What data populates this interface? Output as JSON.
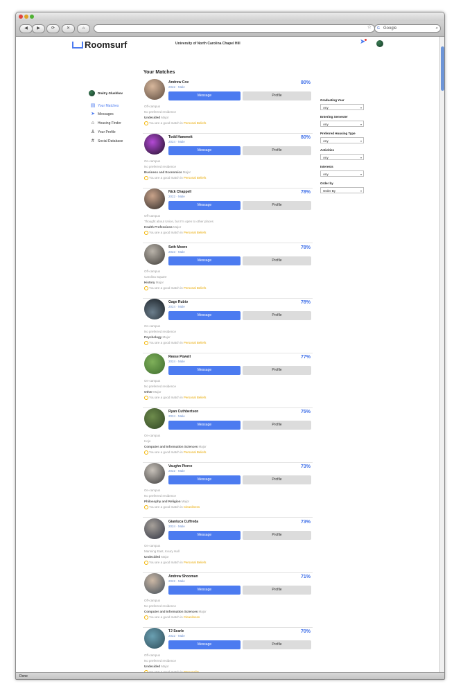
{
  "browser": {
    "search_label": "Google",
    "status_text": "Done"
  },
  "header": {
    "logo": "Roomsurf",
    "school": "University of North Carolina Chapel Hill"
  },
  "sidebar": {
    "user_name": "Dmitry Glushkov",
    "items": [
      {
        "label": "Your Matches",
        "icon": "matches-icon"
      },
      {
        "label": "Messages",
        "icon": "messages-icon"
      },
      {
        "label": "Housing Finder",
        "icon": "house-icon"
      },
      {
        "label": "Your Profile",
        "icon": "user-icon"
      },
      {
        "label": "Social Database",
        "icon": "hashtag-icon"
      }
    ]
  },
  "main": {
    "heading": "Your Matches",
    "message_label": "Message",
    "profile_label": "Profile",
    "match_prefix": "You are a good match in ",
    "major_suffix": "Major",
    "matches": [
      {
        "name": "Andrew Cox",
        "meta": "2022 · Male",
        "pct": "80%",
        "housing": "Off-campus",
        "residence": "No preferred residence",
        "major": "Undecided",
        "trait": "Personal Beliefs"
      },
      {
        "name": "Todd Hammett",
        "meta": "2024 · Male",
        "pct": "80%",
        "housing": "On-campus",
        "residence": "No preferred residence",
        "major": "Business and Economics",
        "trait": "Personal Beliefs"
      },
      {
        "name": "Nick Chappell",
        "meta": "2022 · Male",
        "pct": "78%",
        "housing": "Off-campus",
        "residence": "Thought about Union, but I'm open to other places",
        "major": "Health Professions",
        "trait": "Personal Beliefs"
      },
      {
        "name": "Seth Moore",
        "meta": "2023 · Male",
        "pct": "78%",
        "housing": "Off-campus",
        "residence": "Carolina Square",
        "major": "History",
        "trait": "Personal Beliefs"
      },
      {
        "name": "Gage Rubio",
        "meta": "2024 · Male",
        "pct": "78%",
        "housing": "On-campus",
        "residence": "No preferred residence",
        "major": "Psychology",
        "trait": "Personal Beliefs"
      },
      {
        "name": "Reese Powell",
        "meta": "2024 · Male",
        "pct": "77%",
        "housing": "On-campus",
        "residence": "No preferred residence",
        "major": "Other",
        "trait": "Personal Beliefs"
      },
      {
        "name": "Ryan Cuthbertson",
        "meta": "2024 · Male",
        "pct": "75%",
        "housing": "On-campus",
        "residence": "Hojo",
        "major": "Computer and Information Sciences",
        "trait": "Personal Beliefs"
      },
      {
        "name": "Vaughn Pierce",
        "meta": "2022 · Male",
        "pct": "73%",
        "housing": "On-campus",
        "residence": "No preferred residence",
        "major": "Philosophy and Religion",
        "trait": "Cleanliness"
      },
      {
        "name": "Gianluca Cuffreda",
        "meta": "2024 · Male",
        "pct": "73%",
        "housing": "On-campus",
        "residence": "Manning East, Koury Hall",
        "major": "Undecided",
        "trait": "Personal Beliefs"
      },
      {
        "name": "Andrew Shooman",
        "meta": "2022 · Male",
        "pct": "71%",
        "housing": "Off-campus",
        "residence": "No preferred residence",
        "major": "Computer and Information Sciences",
        "trait": "Cleanliness"
      },
      {
        "name": "TJ Searle",
        "meta": "2022 · Male",
        "pct": "70%",
        "housing": "Off-campus",
        "residence": "No preferred residence",
        "major": "Undecided",
        "trait": "Personality"
      }
    ]
  },
  "filters": [
    {
      "label": "Graduating Year",
      "value": "Any"
    },
    {
      "label": "Entering Semester",
      "value": "Any"
    },
    {
      "label": "Preferred Housing Type",
      "value": "Any"
    },
    {
      "label": "Activities",
      "value": "Any"
    },
    {
      "label": "Interests",
      "value": "Any"
    },
    {
      "label": "Order by",
      "value": "Order By"
    }
  ],
  "colors": {
    "accent": "#4c7bf0",
    "percent": "#3d6ee8",
    "highlight": "#e8a900"
  }
}
